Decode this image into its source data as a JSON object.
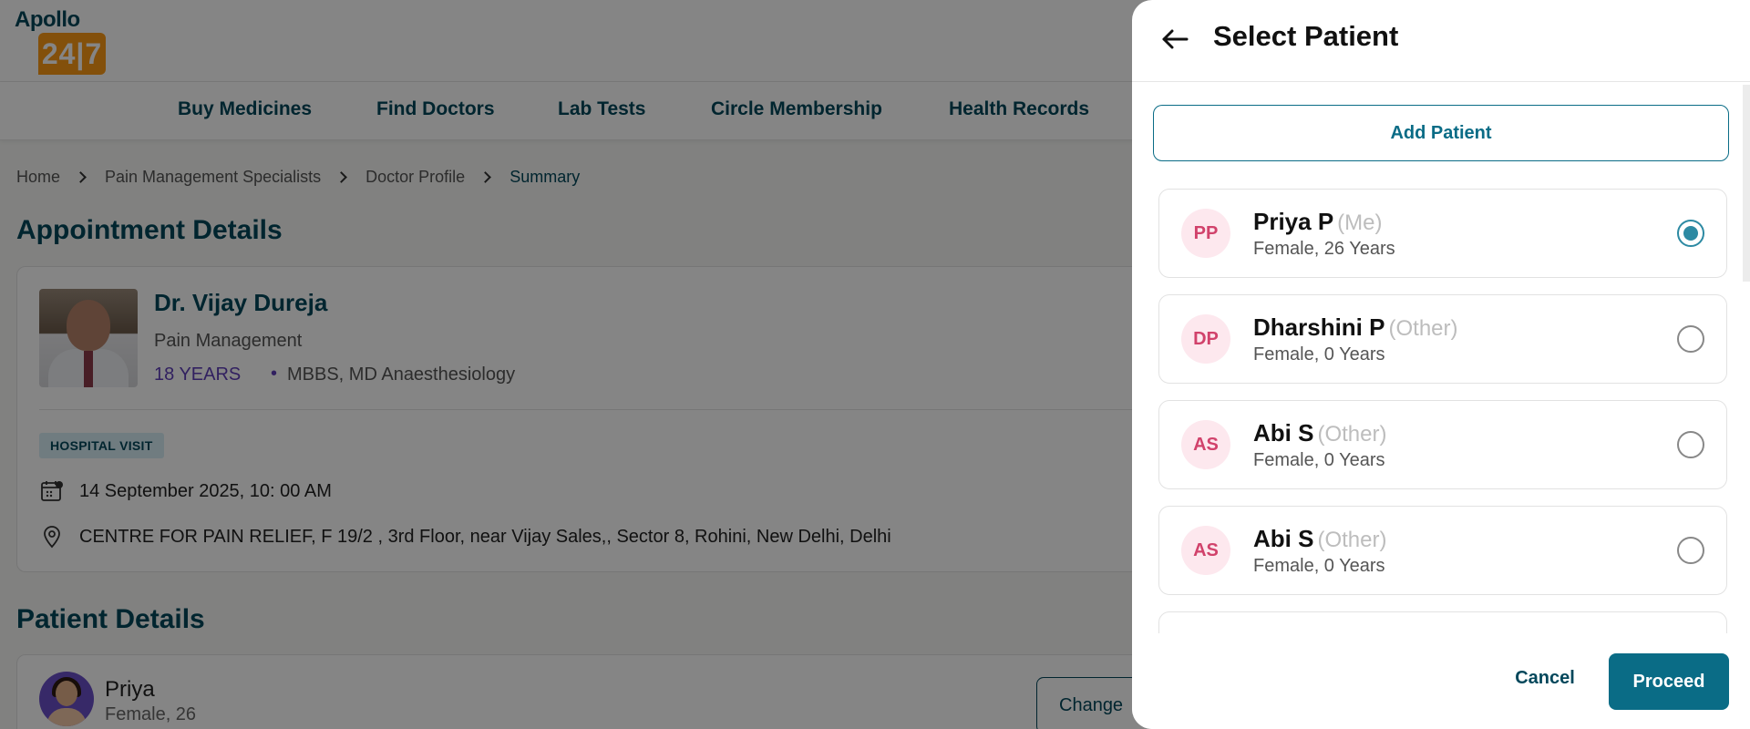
{
  "header": {
    "logo_top": "Apollo",
    "logo_bottom": "24|7"
  },
  "nav": {
    "items": [
      "Buy Medicines",
      "Find Doctors",
      "Lab Tests",
      "Circle Membership",
      "Health Records"
    ]
  },
  "breadcrumb": {
    "items": [
      "Home",
      "Pain Management Specialists",
      "Doctor Profile",
      "Summary"
    ]
  },
  "appointment": {
    "section_title": "Appointment Details",
    "doctor_name": "Dr. Vijay Dureja",
    "specialty": "Pain Management",
    "experience": "18 YEARS",
    "bullet": "•",
    "degrees": "MBBS, MD Anaesthesiology",
    "visit_type": "HOSPITAL VISIT",
    "datetime": "14 September 2025, 10: 00 AM",
    "address": "CENTRE FOR PAIN RELIEF, F 19/2 , 3rd Floor, near Vijay Sales,, Sector 8, Rohini, New Delhi, Delhi"
  },
  "patient_details": {
    "section_title": "Patient Details",
    "name": "Priya",
    "meta": "Female, 26",
    "change_label": "Change"
  },
  "drawer": {
    "title": "Select Patient",
    "add_patient_label": "Add Patient",
    "patients": [
      {
        "initials": "PP",
        "name": "Priya P",
        "relation": "(Me)",
        "meta": "Female, 26 Years",
        "selected": true
      },
      {
        "initials": "DP",
        "name": "Dharshini P",
        "relation": "(Other)",
        "meta": "Female, 0 Years",
        "selected": false
      },
      {
        "initials": "AS",
        "name": "Abi S",
        "relation": "(Other)",
        "meta": "Female, 0 Years",
        "selected": false
      },
      {
        "initials": "AS",
        "name": "Abi S",
        "relation": "(Other)",
        "meta": "Female, 0 Years",
        "selected": false
      }
    ],
    "cancel_label": "Cancel",
    "proceed_label": "Proceed"
  },
  "colors": {
    "brand_teal": "#0a6c86",
    "brand_orange": "#fc9916",
    "radio_selected": "#2d8aa3",
    "initials_text": "#d1426b",
    "initials_bg": "#fde8ee",
    "experience_purple": "#5e3eb8"
  },
  "icons": {
    "back": "arrow-left-icon",
    "calendar": "calendar-icon",
    "location": "location-pin-icon",
    "breadcrumb_sep": "chevron-right-icon"
  }
}
